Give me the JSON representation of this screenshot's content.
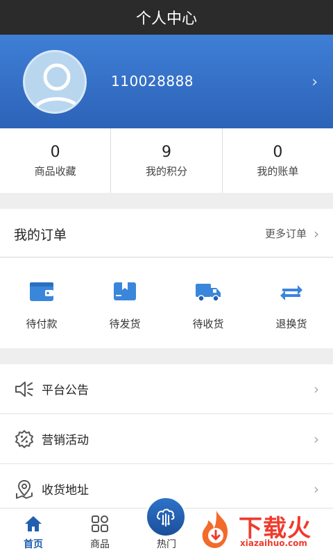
{
  "header": {
    "title": "个人中心"
  },
  "profile": {
    "user_id": "110028888",
    "avatar_icon": "user-avatar-icon",
    "chevron_icon": "chevron-right-icon"
  },
  "stats": [
    {
      "value": "0",
      "label": "商品收藏"
    },
    {
      "value": "9",
      "label": "我的积分"
    },
    {
      "value": "0",
      "label": "我的账单"
    }
  ],
  "orders": {
    "title": "我的订单",
    "more": "更多订单",
    "items": [
      {
        "label": "待付款",
        "icon": "wallet-icon"
      },
      {
        "label": "待发货",
        "icon": "package-icon"
      },
      {
        "label": "待收货",
        "icon": "truck-icon"
      },
      {
        "label": "退换货",
        "icon": "exchange-icon"
      }
    ]
  },
  "menu": [
    {
      "label": "平台公告",
      "icon": "speaker-icon"
    },
    {
      "label": "营销活动",
      "icon": "discount-icon"
    },
    {
      "label": "收货地址",
      "icon": "map-pin-icon"
    }
  ],
  "tabs": [
    {
      "label": "首页",
      "icon": "home-icon",
      "active": true
    },
    {
      "label": "商品",
      "icon": "grid-icon",
      "active": false
    },
    {
      "label": "热门",
      "icon": "hot-icon",
      "active": false
    }
  ],
  "watermark": {
    "title": "下载火",
    "url": "xiazaihuo.com"
  },
  "colors": {
    "primary": "#2c63b8",
    "accent_red": "#ef3b2c"
  }
}
